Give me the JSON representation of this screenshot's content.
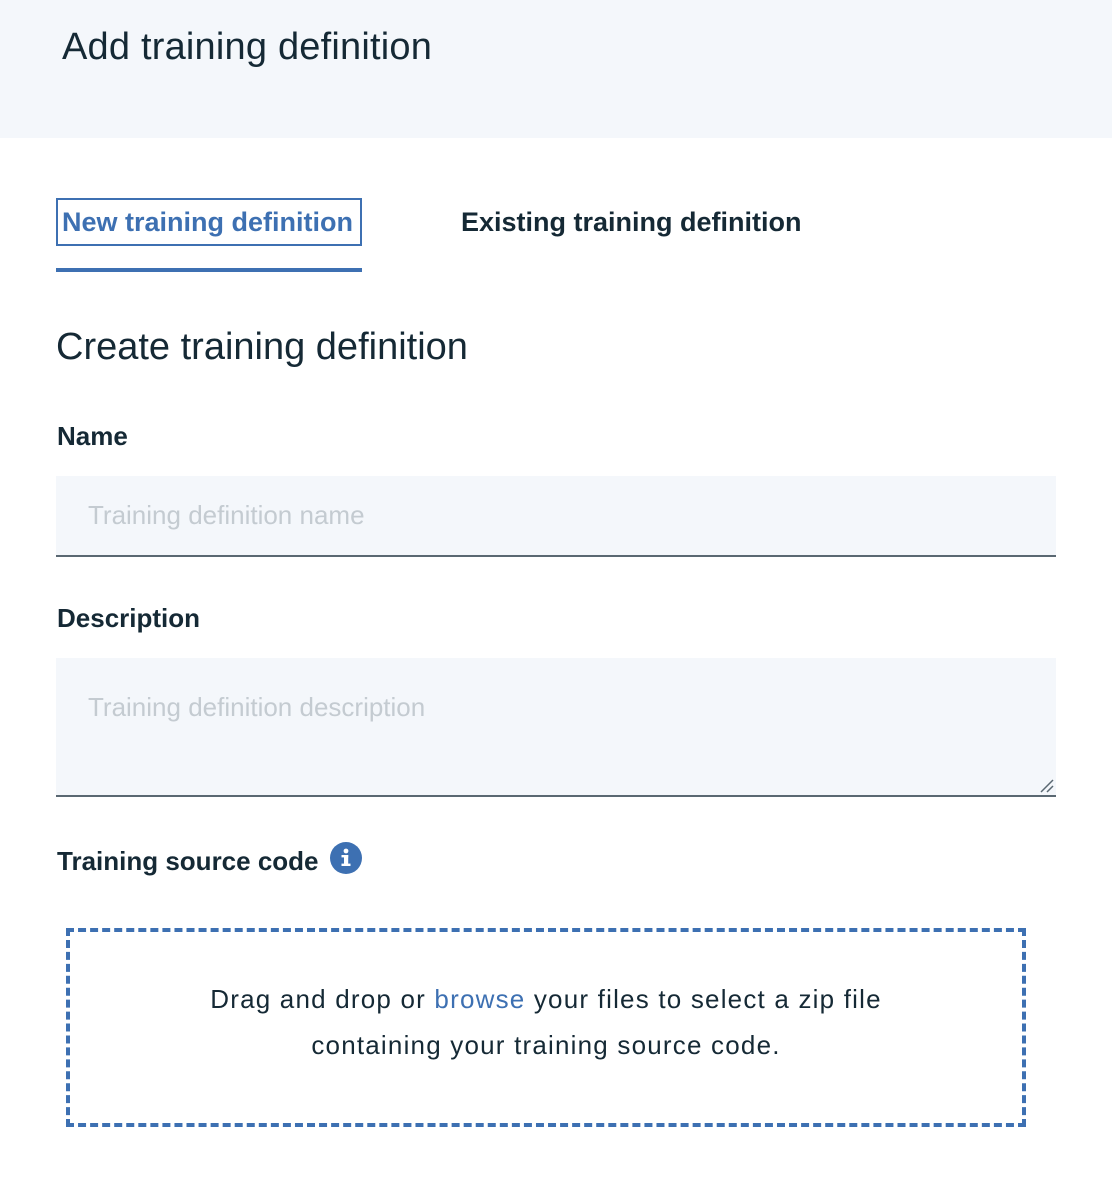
{
  "header": {
    "title": "Add training definition"
  },
  "tabs": [
    {
      "label": "New training definition",
      "selected": true
    },
    {
      "label": "Existing training definition",
      "selected": false
    }
  ],
  "form": {
    "section_title": "Create training definition",
    "name": {
      "label": "Name",
      "placeholder": "Training definition name",
      "value": ""
    },
    "description": {
      "label": "Description",
      "placeholder": "Training definition description",
      "value": ""
    },
    "source_code": {
      "label": "Training source code",
      "info_icon": "info-icon",
      "dropzone": {
        "text_before": "Drag and drop or ",
        "link": "browse",
        "text_after_line1": " your files to select a zip file",
        "line2": "containing your training source code."
      }
    }
  },
  "colors": {
    "accent": "#3d70b2",
    "text": "#152935",
    "field_bg": "#f4f7fb",
    "placeholder": "#c4cbd1"
  }
}
